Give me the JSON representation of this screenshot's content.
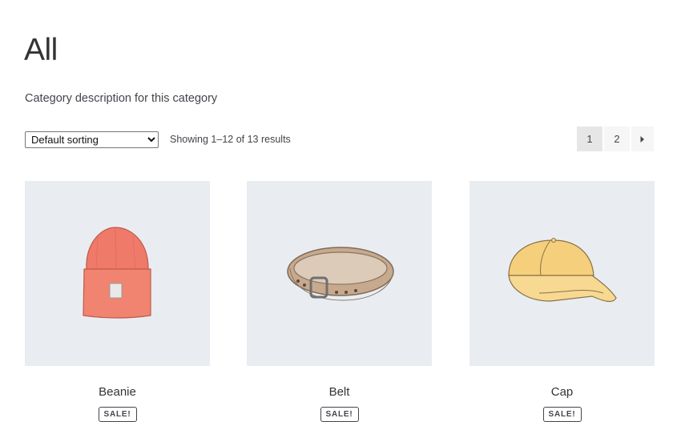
{
  "page": {
    "title": "All",
    "description": "Category description for this category"
  },
  "toolbar": {
    "sort_options": [
      "Default sorting"
    ],
    "sort_selected": "Default sorting",
    "result_count": "Showing 1–12 of 13 results"
  },
  "pagination": {
    "pages": [
      "1",
      "2"
    ],
    "current": "1",
    "next_icon": "caret-right-icon"
  },
  "products": [
    {
      "name": "Beanie",
      "badge": "SALE!",
      "image_icon": "beanie-icon",
      "image_color": "#ef7a6a"
    },
    {
      "name": "Belt",
      "badge": "SALE!",
      "image_icon": "belt-icon",
      "image_color": "#c7a98d"
    },
    {
      "name": "Cap",
      "badge": "SALE!",
      "image_icon": "cap-icon",
      "image_color": "#f5cf7c"
    }
  ]
}
